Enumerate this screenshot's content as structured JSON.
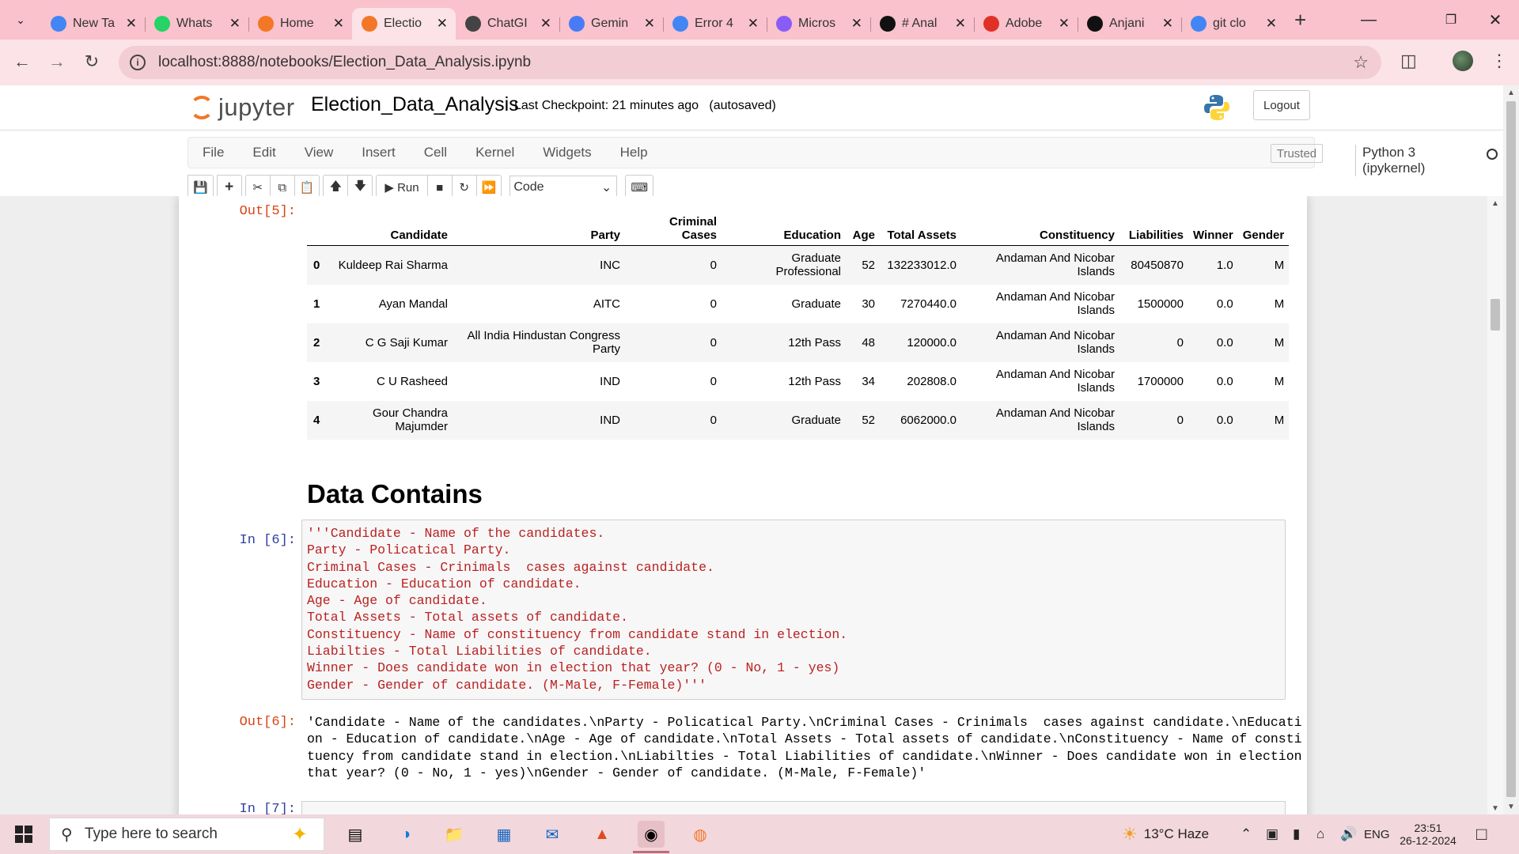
{
  "browser": {
    "tabs": [
      {
        "label": "New Ta",
        "icon_color": "#4285f4",
        "active": false
      },
      {
        "label": "Whats",
        "icon_color": "#25d366",
        "active": false
      },
      {
        "label": "Home",
        "icon_color": "#f37726",
        "active": false
      },
      {
        "label": "Electio",
        "icon_color": "#f37726",
        "active": true
      },
      {
        "label": "ChatGI",
        "icon_color": "#444444",
        "active": false
      },
      {
        "label": "Gemin",
        "icon_color": "#4a7bf7",
        "active": false
      },
      {
        "label": "Error 4",
        "icon_color": "#4285f4",
        "active": false
      },
      {
        "label": "Micros",
        "icon_color": "#8a5cf6",
        "active": false
      },
      {
        "label": "# Anal",
        "icon_color": "#111111",
        "active": false
      },
      {
        "label": "Adobe",
        "icon_color": "#e03127",
        "active": false
      },
      {
        "label": "Anjani",
        "icon_color": "#111111",
        "active": false
      },
      {
        "label": "git clo",
        "icon_color": "#4285f4",
        "active": false
      }
    ],
    "url": "localhost:8888/notebooks/Election_Data_Analysis.ipynb"
  },
  "jupyter": {
    "logo_text": "jupyter",
    "notebook_title": "Election_Data_Analysis",
    "checkpoint": "Last Checkpoint: 21 minutes ago",
    "autosave": "(autosaved)",
    "logout_label": "Logout",
    "menu": [
      "File",
      "Edit",
      "View",
      "Insert",
      "Cell",
      "Kernel",
      "Widgets",
      "Help"
    ],
    "trusted_label": "Trusted",
    "kernel_label": "Python 3 (ipykernel)",
    "run_label": "Run",
    "cell_type": "Code"
  },
  "notebook": {
    "out5_prompt": "Out[5]:",
    "table": {
      "headers": [
        "",
        "Candidate",
        "Party",
        "Criminal Cases",
        "Education",
        "Age",
        "Total Assets",
        "Constituency",
        "Liabilities",
        "Winner",
        "Gender"
      ],
      "rows": [
        [
          "0",
          "Kuldeep Rai Sharma",
          "INC",
          "0",
          "Graduate Professional",
          "52",
          "132233012.0",
          "Andaman And Nicobar Islands",
          "80450870",
          "1.0",
          "M"
        ],
        [
          "1",
          "Ayan Mandal",
          "AITC",
          "0",
          "Graduate",
          "30",
          "7270440.0",
          "Andaman And Nicobar Islands",
          "1500000",
          "0.0",
          "M"
        ],
        [
          "2",
          "C G Saji Kumar",
          "All India Hindustan Congress Party",
          "0",
          "12th Pass",
          "48",
          "120000.0",
          "Andaman And Nicobar Islands",
          "0",
          "0.0",
          "M"
        ],
        [
          "3",
          "C U Rasheed",
          "IND",
          "0",
          "12th Pass",
          "34",
          "202808.0",
          "Andaman And Nicobar Islands",
          "1700000",
          "0.0",
          "M"
        ],
        [
          "4",
          "Gour Chandra Majumder",
          "IND",
          "0",
          "Graduate",
          "52",
          "6062000.0",
          "Andaman And Nicobar Islands",
          "0",
          "0.0",
          "M"
        ]
      ]
    },
    "markdown_heading": "Data Contains",
    "in6_prompt": "In [6]:",
    "code_lines": [
      "'''Candidate - Name of the candidates.",
      "Party - Policatical Party.",
      "Criminal Cases - Crinimals  cases against candidate.",
      "Education - Education of candidate.",
      "Age - Age of candidate.",
      "Total Assets - Total assets of candidate.",
      "Constituency - Name of constituency from candidate stand in election.",
      "Liabilties - Total Liabilities of candidate.",
      "Winner - Does candidate won in election that year? (0 - No, 1 - yes)",
      "Gender - Gender of candidate. (M-Male, F-Female)'''"
    ],
    "out6_prompt": "Out[6]:",
    "out6_lines": [
      "'Candidate - Name of the candidates.\\nParty - Policatical Party.\\nCriminal Cases - Crinimals  cases against candidate.\\nEducati",
      "on - Education of candidate.\\nAge - Age of candidate.\\nTotal Assets - Total assets of candidate.\\nConstituency - Name of consti",
      "tuency from candidate stand in election.\\nLiabilties - Total Liabilities of candidate.\\nWinner - Does candidate won in election",
      "that year? (0 - No, 1 - yes)\\nGender - Gender of candidate. (M-Male, F-Female)'"
    ],
    "in7_prompt": "In [7]:"
  },
  "taskbar": {
    "search_placeholder": "Type here to search",
    "weather": "13°C  Haze",
    "lang": "ENG",
    "time": "23:51",
    "date": "26-12-2024"
  }
}
